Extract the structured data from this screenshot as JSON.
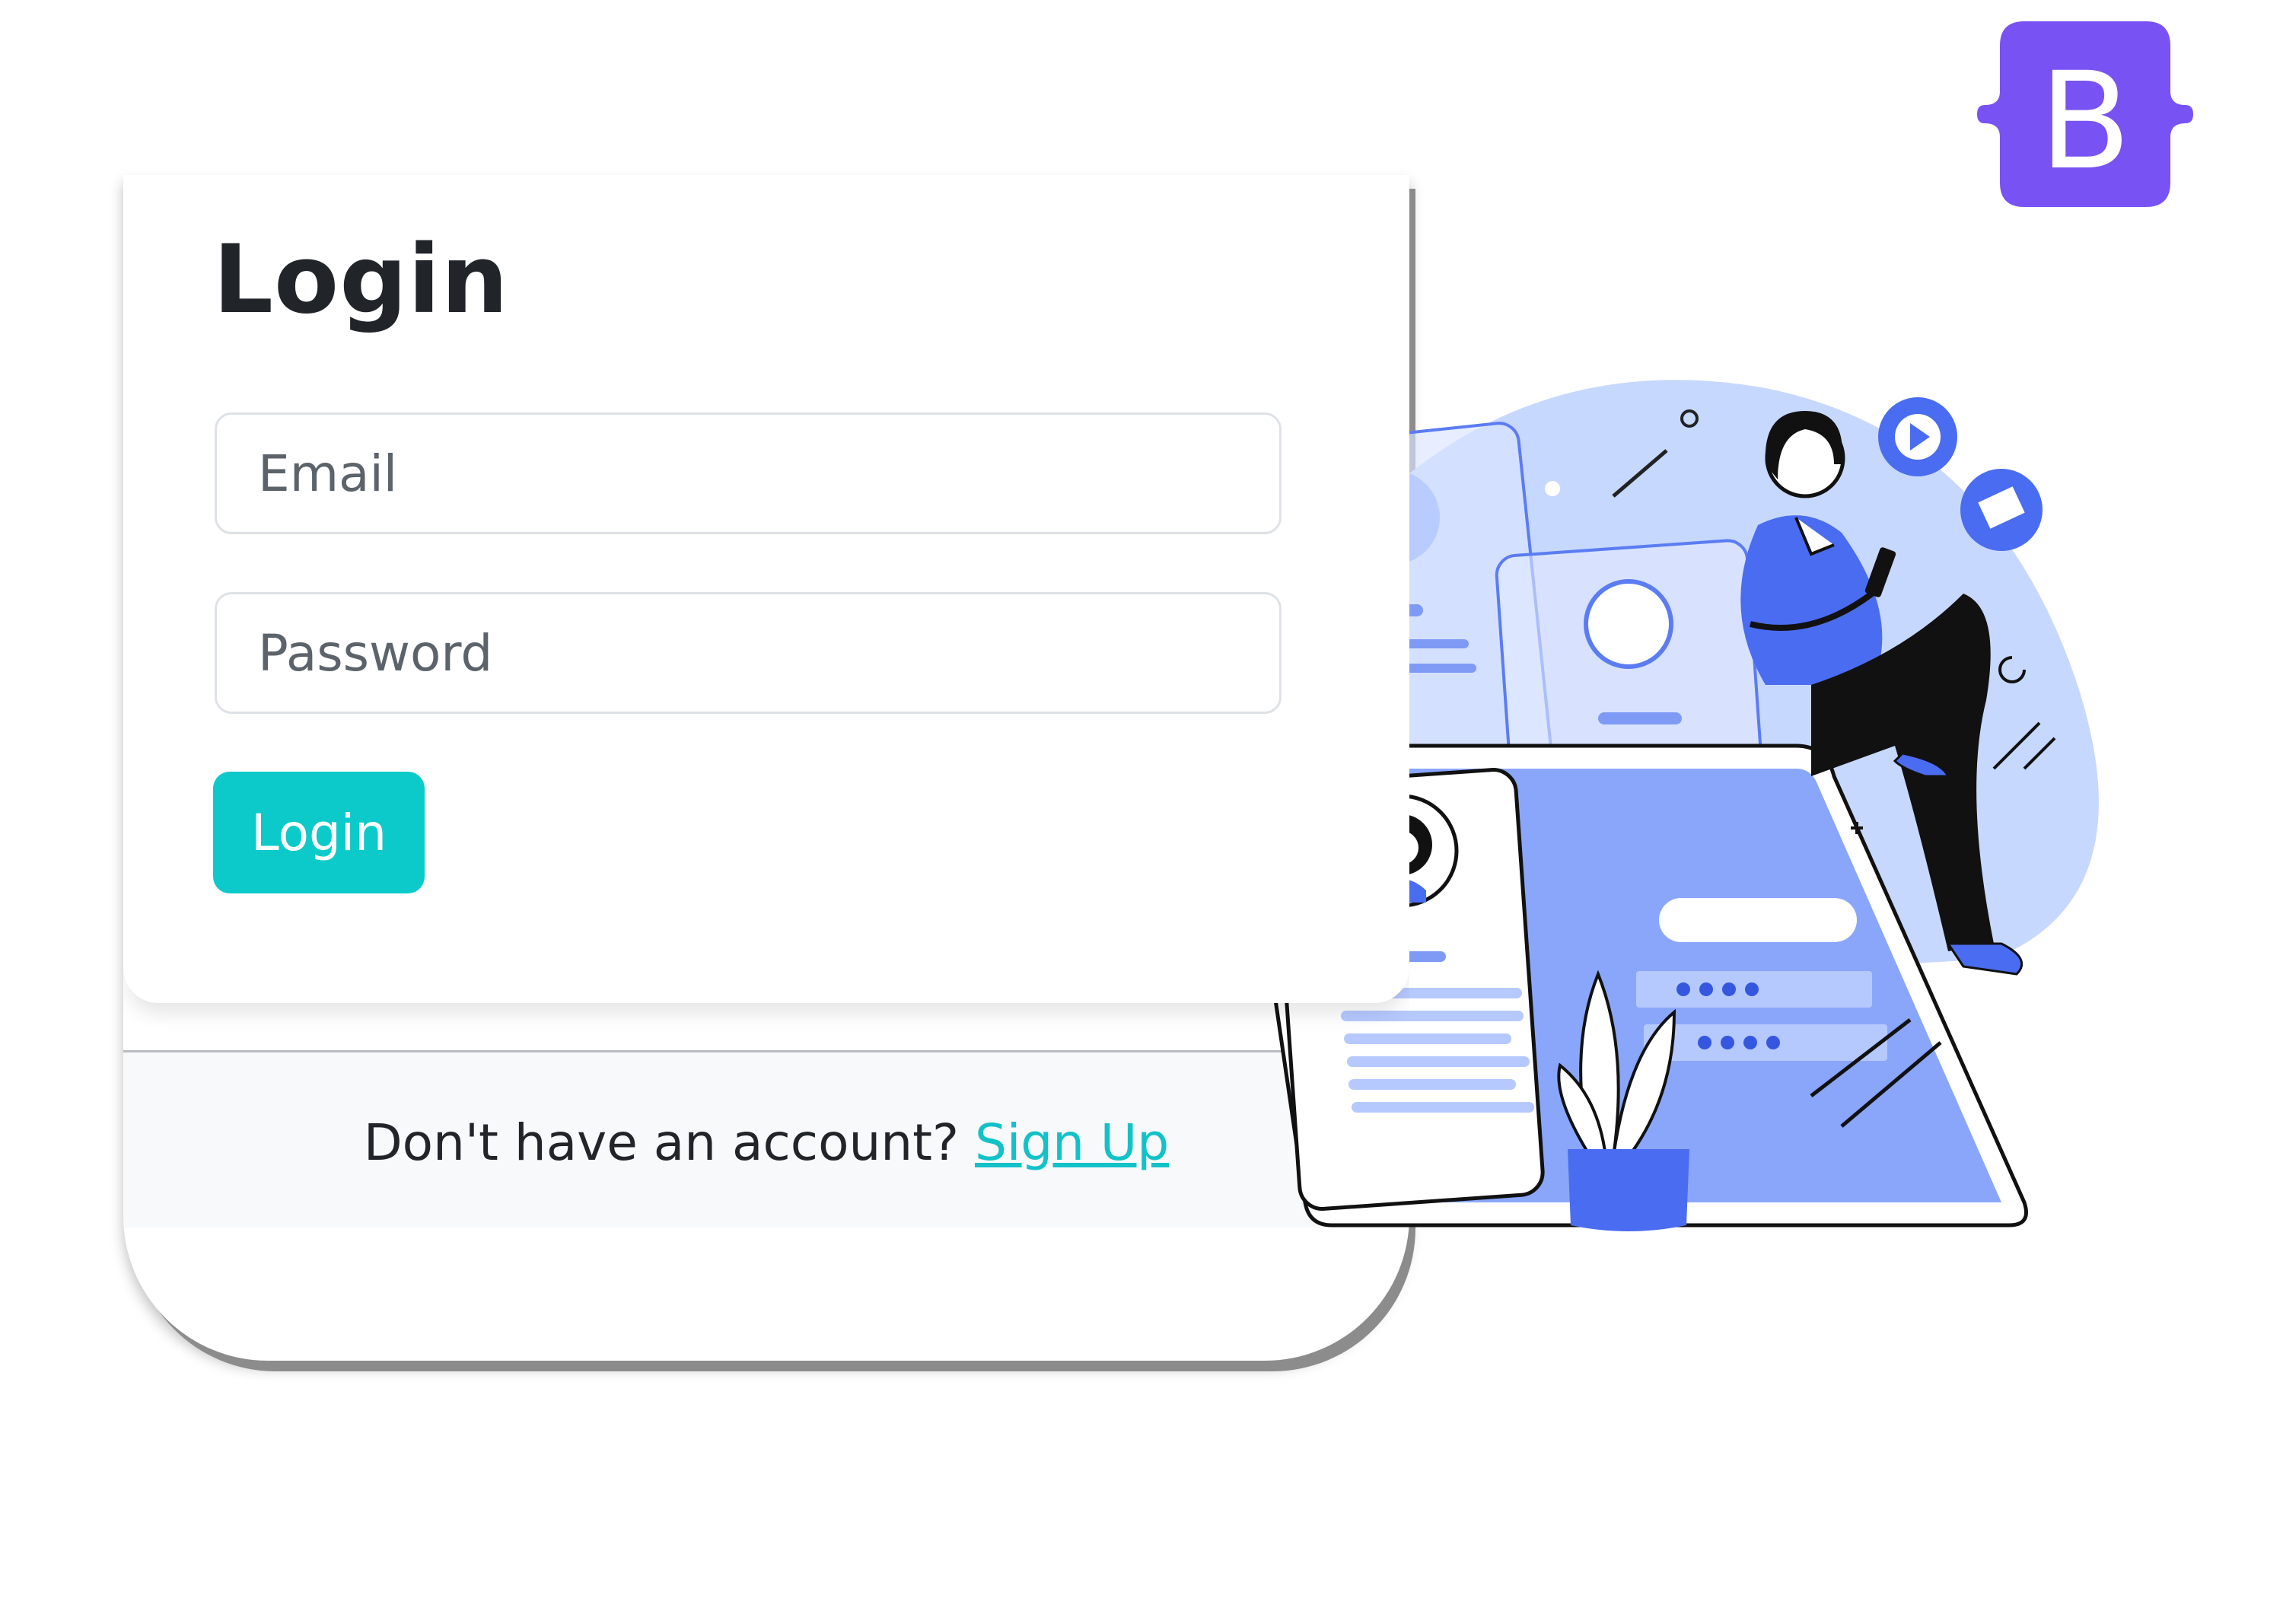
{
  "login": {
    "title": "Login",
    "email_placeholder": "Email",
    "password_placeholder": "Password",
    "button_label": "Login"
  },
  "footer": {
    "prompt": "Don't have an account?",
    "link": "Sign Up"
  },
  "logo": {
    "letter": "B",
    "color": "#7952f3"
  },
  "colors": {
    "accent": "#0dcaca",
    "illustration_blue": "#5b7cf2",
    "illustration_light": "#c7d8ff"
  }
}
